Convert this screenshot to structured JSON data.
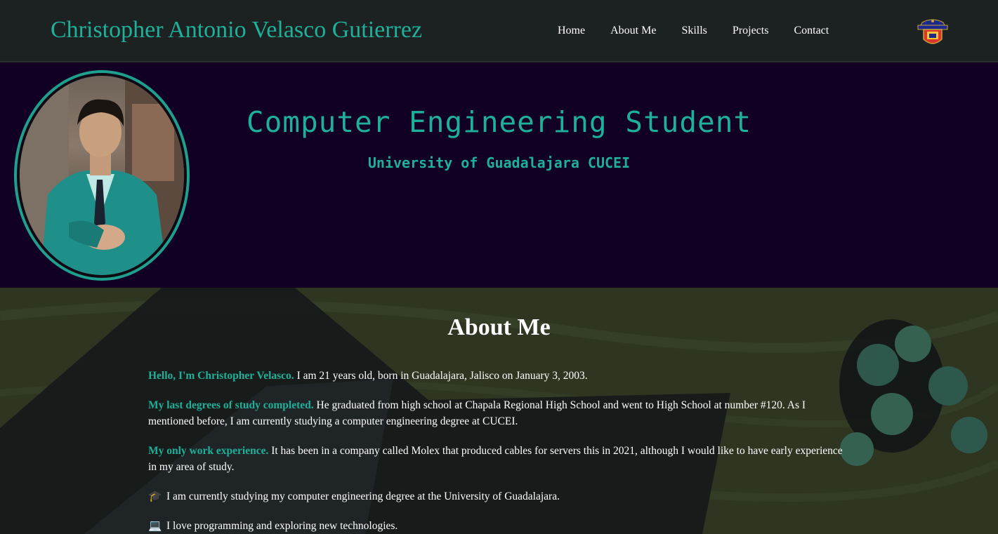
{
  "header": {
    "title": "Christopher Antonio Velasco Gutierrez",
    "nav": [
      {
        "label": "Home"
      },
      {
        "label": "About Me"
      },
      {
        "label": "Skills"
      },
      {
        "label": "Projects"
      },
      {
        "label": "Contact"
      }
    ],
    "crest_icon": "university-crest-icon"
  },
  "hero": {
    "title": "Computer Engineering Student",
    "subtitle": "University of Guadalajara CUCEI",
    "avatar_icon": "profile-photo"
  },
  "about": {
    "title": "About Me",
    "paragraphs": [
      {
        "highlight": "Hello, I'm Christopher Velasco.",
        "text": " I am 21 years old, born in Guadalajara, Jalisco on January 3, 2003."
      },
      {
        "highlight": "My last degrees of study completed.",
        "text": " He graduated from high school at Chapala Regional High School and went to High School at number #120. As I mentioned before, I am currently studying a computer engineering degree at CUCEI."
      },
      {
        "highlight": "My only work experience.",
        "text": " It has been in a company called Molex that produced cables for servers this in 2021, although I would like to have early experience in my area of study."
      }
    ],
    "bullets": [
      {
        "emoji": "🎓",
        "text": "I am currently studying my computer engineering degree at the University of Guadalajara."
      },
      {
        "emoji": "💻",
        "text": "I love programming and exploring new technologies."
      }
    ]
  },
  "colors": {
    "accent": "#1fb09a",
    "header_bg": "#1c2122",
    "hero_bg": "#110023"
  }
}
